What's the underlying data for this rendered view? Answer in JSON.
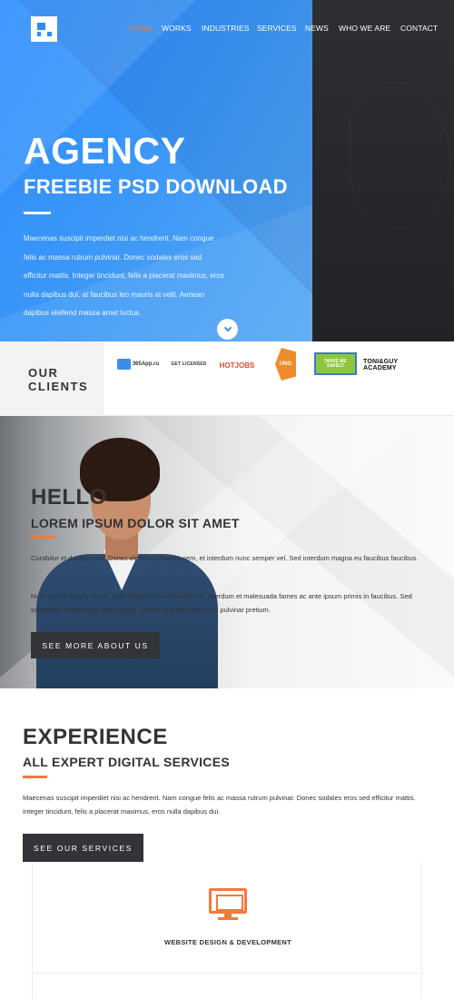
{
  "nav": {
    "items": [
      "HOME",
      "WORKS",
      "INDUSTRIES",
      "SERVICES",
      "NEWS",
      "WHO WE ARE",
      "CONTACT"
    ],
    "active_color": "#f07a3a"
  },
  "hero": {
    "title": "AGENCY",
    "subtitle": "FREEBIE PSD DOWNLOAD",
    "paragraph": "Maecenas suscipit imperdiet nisi ac hendrerit. Nam congue felis ac massa rutrum pulvinar. Donec sodales eros sed efficitur mattis. Integer tincidunt, felis a placerat maximus, eros nulla dapibus dui, at faucibus leo mauris at velit. Aenean dapibus eleifend massa amet luctus.",
    "blue": "#2b8cff",
    "dark": "#2a2b2f",
    "scroll_icon": "chevron-down-icon"
  },
  "clients": {
    "heading_line1": "OUR",
    "heading_line2": "CLIENTS",
    "logos": [
      {
        "name": "365app-logo",
        "text": "365App.ru"
      },
      {
        "name": "licensed-logo",
        "text": "GET LICENSED"
      },
      {
        "name": "hotjobs-logo",
        "text": "HOTJOBS"
      },
      {
        "name": "ung-logo",
        "text": "UNG"
      },
      {
        "name": "drive-me-safely-logo",
        "text": "DRIVE ME SAFELY"
      },
      {
        "name": "toni-guy-logo",
        "text": "TONI&GUY ACADEMY"
      }
    ]
  },
  "hello": {
    "title": "HELLO",
    "subtitle": "LOREM IPSUM DOLOR SIT AMET",
    "p1": "Curabitur et dapibus nisi. Donec eleifend pharetra sem, et interdum nunc semper vel. Sed interdum magna eu faucibus faucibus.",
    "p2": "Nulla varius tempor quam, eget aliquet ante sollicitudin ut. Interdum et malesuada fames ac ante ipsum primis in faucibus. Sed sollicitudin scelerisque varius porta. Donec sit amet diam a elit pulvinar pretium.",
    "button": "SEE MORE ABOUT US"
  },
  "experience": {
    "title": "EXPERIENCE",
    "subtitle": "ALL EXPERT DIGITAL SERVICES",
    "paragraph": "Maecenas suscipit imperdiet nisi ac hendrerit. Nam congue felis ac massa rutrum pulvinar. Donec sodales eros sed efficitur mattis. Integer tincidunt, felis a placerat maximus, eros nulla dapibus dui.",
    "button": "SEE OUR SERVICES",
    "accent": "#f07a3a"
  },
  "services": [
    {
      "label": "WEBSITE DESIGN & DEVELOPMENT",
      "icon": "monitor-icon"
    }
  ]
}
